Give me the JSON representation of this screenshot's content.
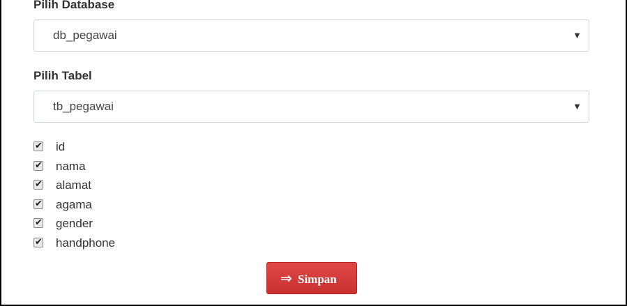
{
  "form": {
    "database": {
      "label": "Pilih Database",
      "selected": "db_pegawai"
    },
    "table": {
      "label": "Pilih Tabel",
      "selected": "tb_pegawai"
    },
    "columns": [
      {
        "label": "id",
        "checked": true
      },
      {
        "label": "nama",
        "checked": true
      },
      {
        "label": "alamat",
        "checked": true
      },
      {
        "label": "agama",
        "checked": true
      },
      {
        "label": "gender",
        "checked": true
      },
      {
        "label": "handphone",
        "checked": true
      }
    ],
    "submit": {
      "label": "Simpan",
      "icon": "save-redirect-icon",
      "color": "#d43f3a"
    }
  }
}
